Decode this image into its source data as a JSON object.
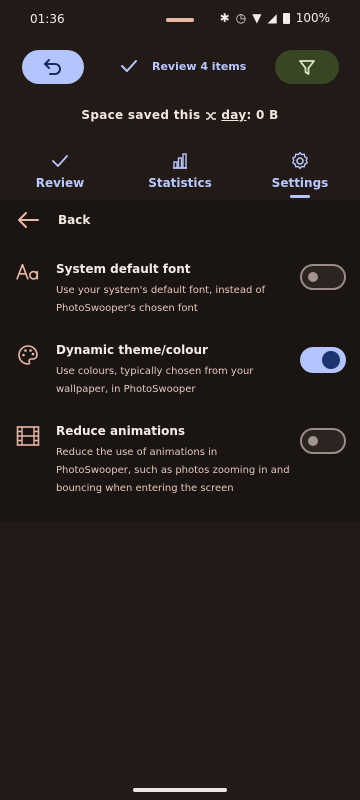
{
  "status_bar": {
    "time": "01:36",
    "battery": "100%",
    "icons": [
      "bluetooth-icon",
      "alarm-icon",
      "wifi-icon",
      "signal-icon",
      "battery-icon"
    ]
  },
  "header": {
    "undo_icon": "undo-icon",
    "review_label": "Review 4 items",
    "check_icon": "check-icon",
    "filter_icon": "filter-icon",
    "space_saved_prefix": "Space saved this",
    "space_saved_period": "day",
    "space_saved_value": ": 0 B"
  },
  "tabs": [
    {
      "label": "Review",
      "icon": "check-icon"
    },
    {
      "label": "Statistics",
      "icon": "bar-chart-icon"
    },
    {
      "label": "Settings",
      "icon": "gear-icon",
      "active": true
    }
  ],
  "back": {
    "label": "Back"
  },
  "settings": [
    {
      "title": "System default font",
      "description": "Use your system's default font, instead of PhotoSwooper's chosen font",
      "icon": "font-icon",
      "enabled": false
    },
    {
      "title": "Dynamic theme/colour",
      "description": "Use colours, typically chosen from your wallpaper, in PhotoSwooper",
      "icon": "palette-icon",
      "enabled": true
    },
    {
      "title": "Reduce animations",
      "description": "Reduce the use of animations in PhotoSwooper, such as photos zooming in and bouncing when entering the screen",
      "icon": "film-icon",
      "enabled": false
    }
  ],
  "colors": {
    "accent": "#b3c4ff",
    "filter_button": "#384624",
    "background": "#221a17"
  }
}
